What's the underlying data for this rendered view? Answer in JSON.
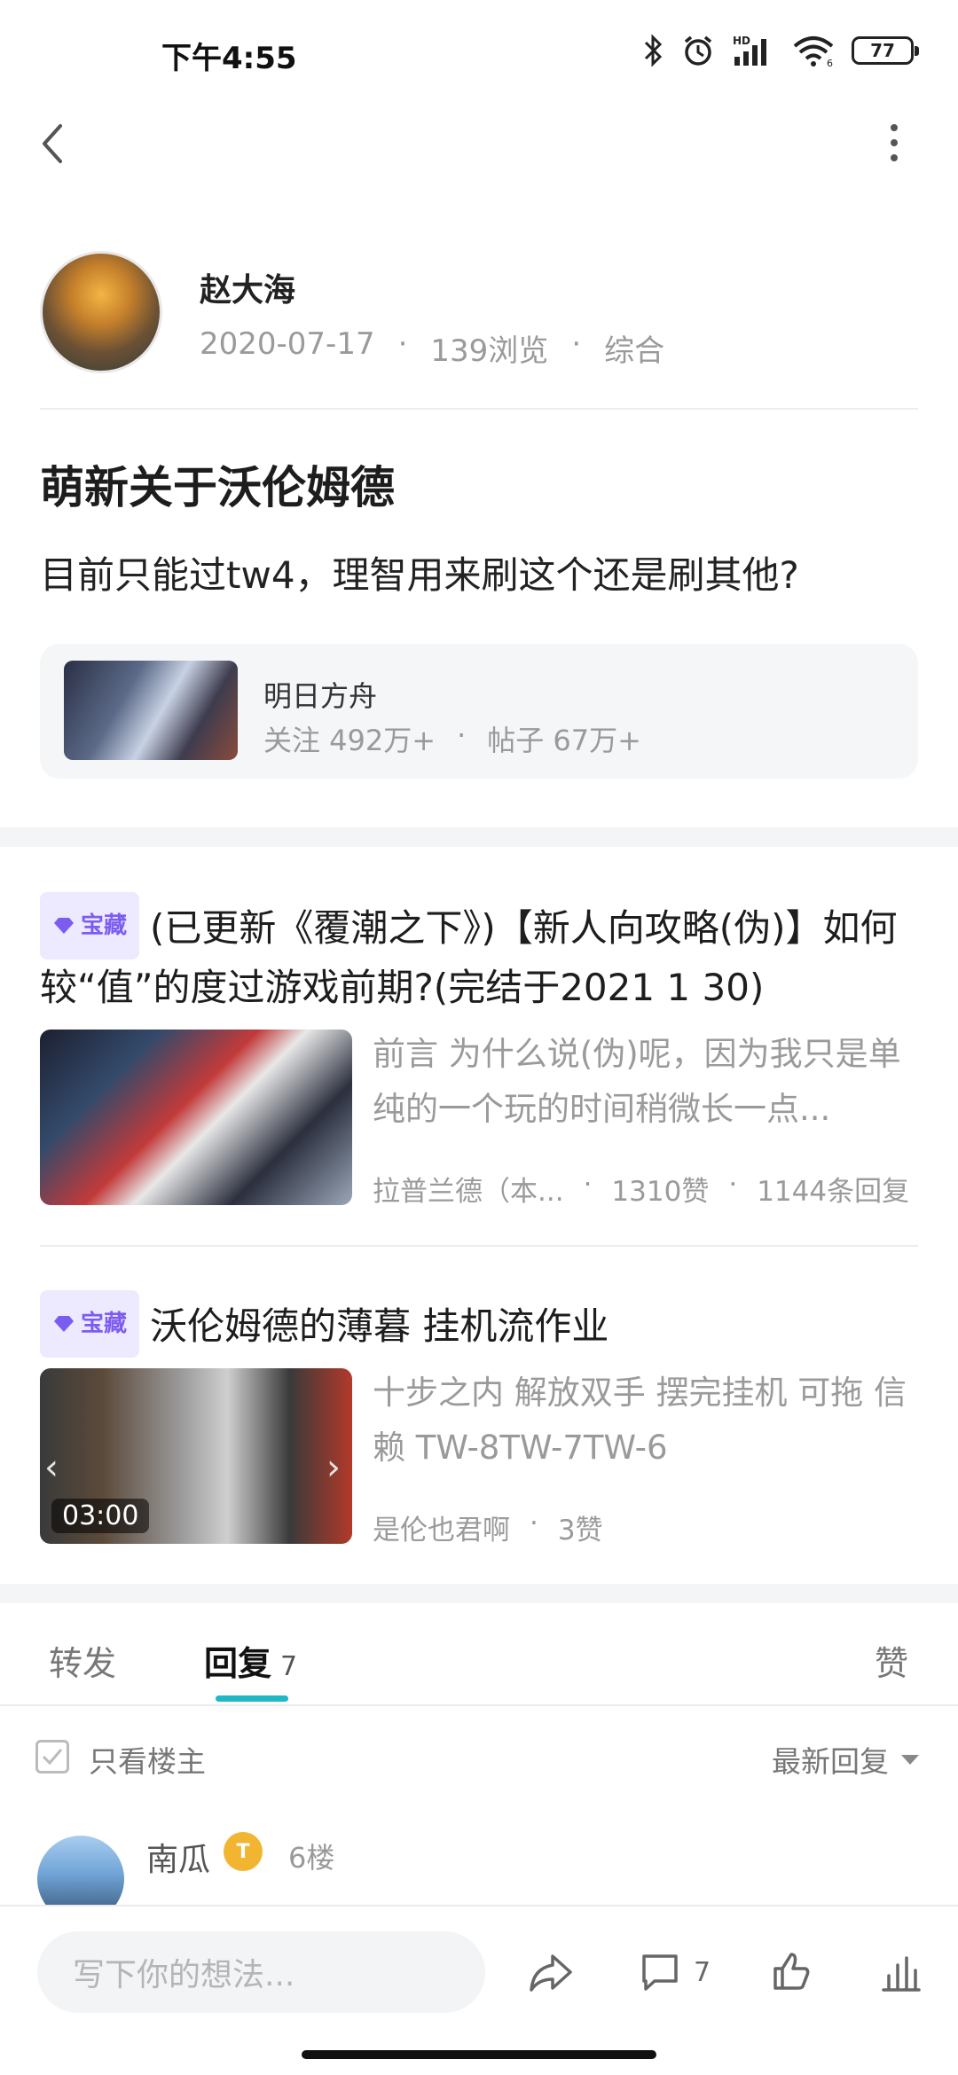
{
  "status_bar": {
    "time": "下午4:55",
    "battery": "77",
    "hd": "HD",
    "signal_sub": "6"
  },
  "author": {
    "name": "赵大海",
    "date": "2020-07-17",
    "views": "139浏览",
    "category": "综合",
    "sep": "·"
  },
  "post": {
    "title": "萌新关于沃伦姆德",
    "body": "目前只能过tw4，理智用来刷这个还是刷其他?"
  },
  "forum": {
    "name": "明日方舟",
    "follows": "关注 492万+",
    "posts": "帖子 67万+",
    "sep": "·"
  },
  "recommended": [
    {
      "tag": "宝藏",
      "title": "(已更新《覆潮之下》)【新人向攻略(伪)】如何较“值”的度过游戏前期?(完结于2021 1 30)",
      "excerpt": "前言 为什么说(伪)呢，因为我只是单纯的一个玩的时间稍微长一点...",
      "author": "拉普兰德（本...",
      "likes": "1310赞",
      "replies": "1144条回复"
    },
    {
      "tag": "宝藏",
      "title": "沃伦姆德的薄暮 挂机流作业",
      "excerpt": "十步之内 解放双手  摆完挂机 可拖 信赖 TW-8TW-7TW-6",
      "author": "是伦也君啊",
      "likes": "3赞",
      "video_time": "03:00"
    }
  ],
  "tabs": {
    "forward": "转发",
    "reply": "回复",
    "reply_count": "7",
    "like": "赞"
  },
  "filter": {
    "only_op": "只看楼主",
    "sort": "最新回复"
  },
  "comment": {
    "name": "南瓜",
    "badge": "T",
    "floor": "6楼"
  },
  "bottom_bar": {
    "placeholder": "写下你的想法...",
    "comment_count": "7"
  },
  "colors": {
    "accent": "#1fb8c7",
    "tag_bg": "#ede9ff",
    "tag_fg": "#7c5cf0",
    "muted": "#9a9a9a"
  },
  "icons": [
    "back-icon",
    "more-icon",
    "bluetooth-icon",
    "alarm-icon",
    "signal-icon",
    "wifi-icon",
    "battery-icon",
    "gem-icon",
    "share-icon",
    "comment-icon",
    "like-icon",
    "stats-icon"
  ]
}
